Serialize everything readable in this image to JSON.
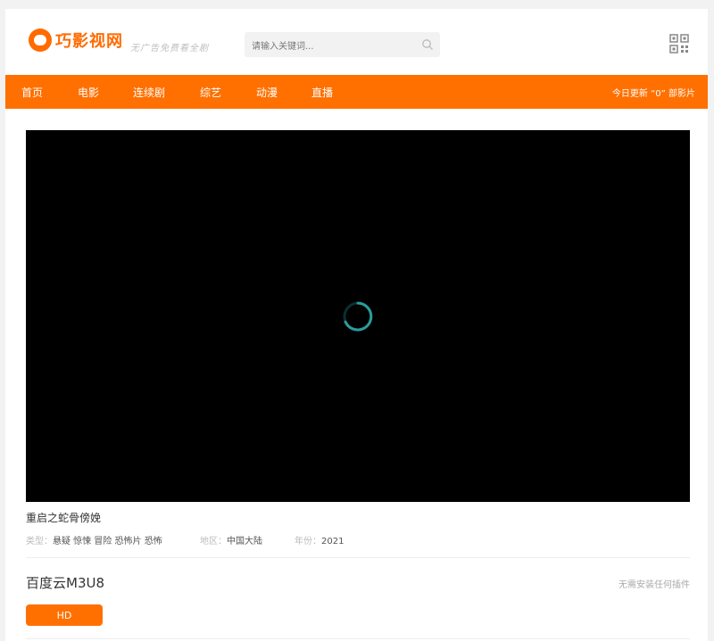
{
  "header": {
    "logo_text": "巧影视网",
    "slogan": "无广告免费看全剧",
    "search": {
      "placeholder": "请输入关键词..."
    },
    "icons": {
      "search": "search-icon",
      "qr": "qr-code-icon",
      "logo": "logo-icon"
    }
  },
  "nav": {
    "items": [
      {
        "label": "首页"
      },
      {
        "label": "电影"
      },
      {
        "label": "连续剧"
      },
      {
        "label": "综艺"
      },
      {
        "label": "动漫"
      },
      {
        "label": "直播"
      }
    ],
    "update_text": "今日更新 “0” 部影片"
  },
  "video": {
    "title": "重启之蛇骨傍娩",
    "type_label": "类型：",
    "type_value": "悬疑 惊悚 冒险 恐怖片 恐怖",
    "region_label": "地区：",
    "region_value": "中国大陆",
    "year_label": "年份：",
    "year_value": "2021",
    "loading": true
  },
  "playlist": {
    "source_name": "百度云M3U8",
    "note": "无需安装任何插件",
    "episodes": [
      {
        "label": "HD"
      }
    ]
  },
  "colors": {
    "accent": "#ff7000",
    "player_bg": "#000000",
    "spinner": "#2a9d9b"
  }
}
